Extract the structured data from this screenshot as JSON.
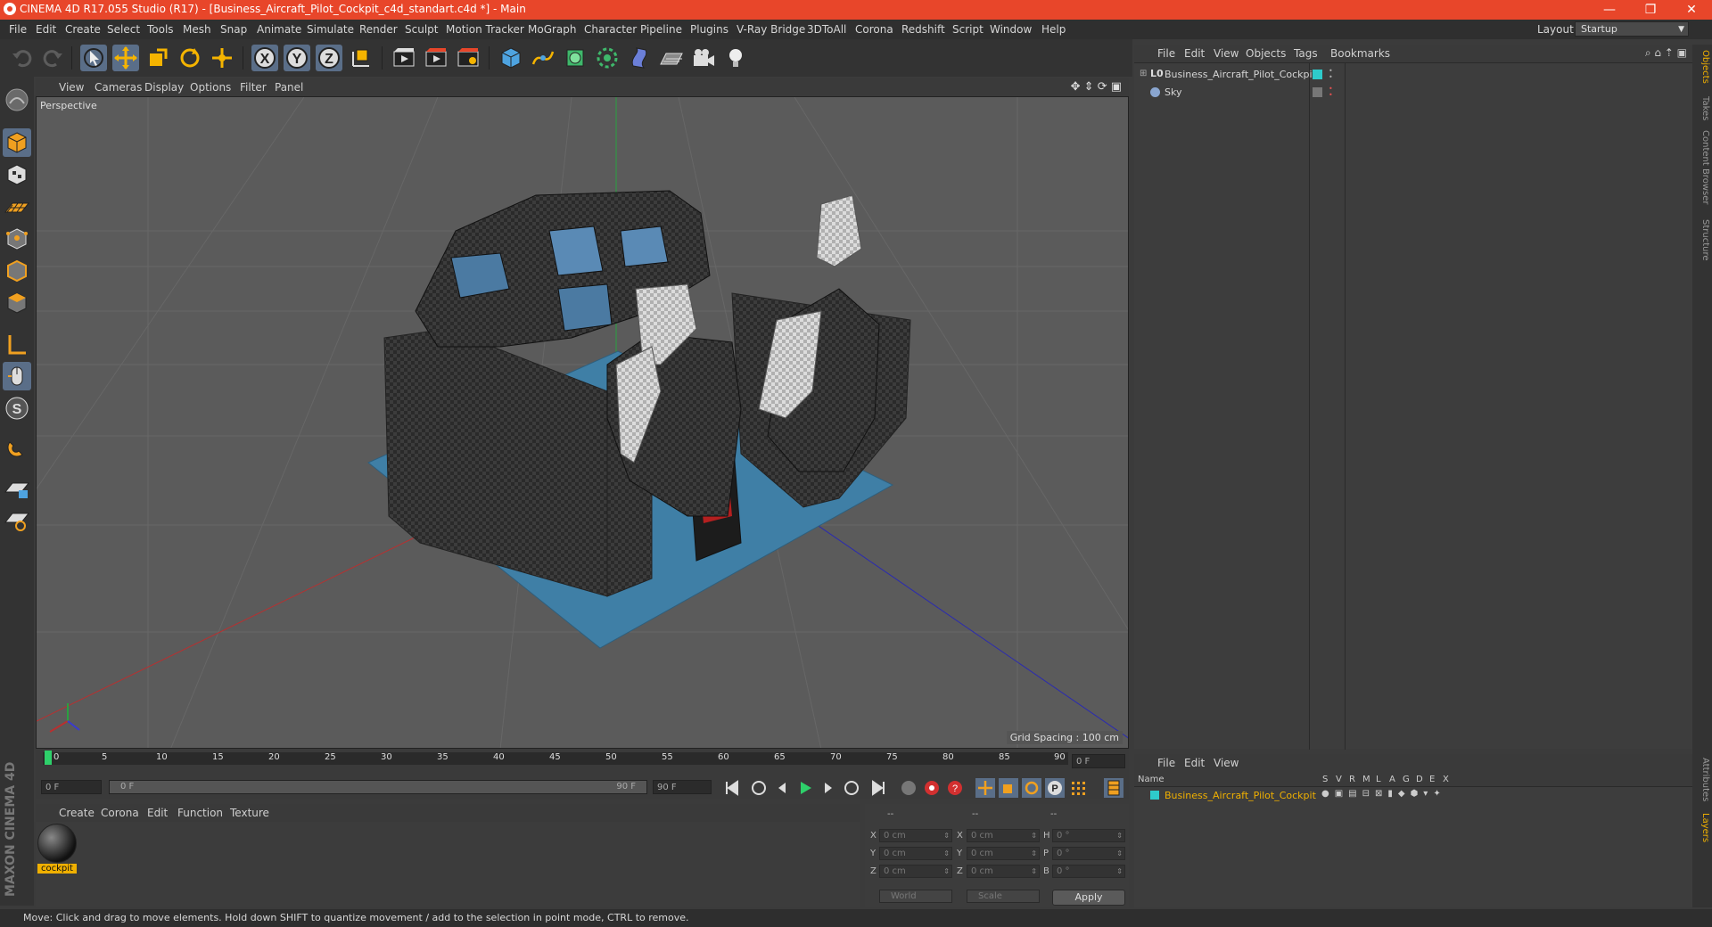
{
  "app": {
    "window_title": "CINEMA 4D R17.055 Studio (R17) - [Business_Aircraft_Pilot_Cockpit_c4d_standart.c4d *] - Main",
    "accent_color": "#e8462a"
  },
  "window_controls": {
    "minimize": "—",
    "maximize": "❐",
    "close": "✕"
  },
  "menubar": {
    "items": [
      "File",
      "Edit",
      "Create",
      "Select",
      "Tools",
      "Mesh",
      "Snap",
      "Animate",
      "Simulate",
      "Render",
      "Sculpt",
      "Motion Tracker",
      "MoGraph",
      "Character",
      "Pipeline",
      "Plugins",
      "V-Ray Bridge",
      "3DToAll",
      "Corona",
      "Redshift",
      "Script",
      "Window",
      "Help"
    ],
    "layout_label": "Layout:",
    "layout_value": "Startup"
  },
  "toolbar": {
    "icons": [
      "undo-icon",
      "redo-icon",
      "select-arrow-icon",
      "move-icon",
      "scale-icon",
      "rotate-icon",
      "transform-icon",
      "x-axis-icon",
      "y-axis-icon",
      "z-axis-icon",
      "world-coord-icon",
      "render-view-icon",
      "render-picture-viewer-icon",
      "render-settings-icon",
      "cube-icon",
      "pen-spline-icon",
      "subdivision-icon",
      "array-icon",
      "deformer-icon",
      "floor-icon",
      "camera-icon",
      "light-icon"
    ],
    "axis_labels": [
      "X",
      "Y",
      "Z"
    ]
  },
  "lefttools": {
    "icons": [
      "make-editable-icon",
      "model-mode-icon",
      "texture-mode-icon",
      "workplane-icon",
      "points-mode-icon",
      "edges-mode-icon",
      "polygons-mode-icon",
      "axis-mode-icon",
      "tweak-icon",
      "solo-icon",
      "snap-icon",
      "lock-workplane-icon",
      "planar-workplane-icon"
    ],
    "brand": "MAXON CINEMA 4D"
  },
  "viewport": {
    "menu": [
      "View",
      "Cameras",
      "Display",
      "Options",
      "Filter",
      "Panel"
    ],
    "label": "Perspective",
    "grid_spacing": "Grid Spacing : 100 cm"
  },
  "timeline": {
    "ticks": [
      "0",
      "5",
      "10",
      "15",
      "20",
      "25",
      "30",
      "35",
      "40",
      "45",
      "50",
      "55",
      "60",
      "65",
      "70",
      "75",
      "80",
      "85",
      "90"
    ],
    "current_frame": "0 F",
    "start_field": "0 F",
    "range_start": "0 F",
    "range_end": "90 F",
    "end_field": "90 F"
  },
  "material_manager": {
    "menu": [
      "Create",
      "Corona",
      "Edit",
      "Function",
      "Texture"
    ],
    "materials": [
      {
        "name": "cockpit"
      }
    ]
  },
  "coordinates": {
    "headers": [
      "--",
      "--",
      "--"
    ],
    "rows": [
      {
        "pos_label": "X",
        "pos": "0 cm",
        "size_label": "X",
        "size": "0 cm",
        "rot_label": "H",
        "rot": "0 °"
      },
      {
        "pos_label": "Y",
        "pos": "0 cm",
        "size_label": "Y",
        "size": "0 cm",
        "rot_label": "P",
        "rot": "0 °"
      },
      {
        "pos_label": "Z",
        "pos": "0 cm",
        "size_label": "Z",
        "size": "0 cm",
        "rot_label": "B",
        "rot": "0 °"
      }
    ],
    "mode_select": "World",
    "scale_select": "Scale",
    "apply_label": "Apply"
  },
  "object_manager": {
    "menu": [
      "File",
      "Edit",
      "View",
      "Objects",
      "Tags",
      "Bookmarks"
    ],
    "objects": [
      {
        "name": "Business_Aircraft_Pilot_Cockpit",
        "tag_color": "#2ecbcb"
      },
      {
        "name": "Sky"
      }
    ]
  },
  "layer_manager": {
    "menu": [
      "File",
      "Edit",
      "View"
    ],
    "columns": [
      "Name",
      "S",
      "V",
      "R",
      "M",
      "L",
      "A",
      "G",
      "D",
      "E",
      "X"
    ],
    "layers": [
      {
        "name": "Business_Aircraft_Pilot_Cockpit",
        "color": "#2ecbcb",
        "text_color": "#f0b000"
      }
    ]
  },
  "side_tabs": [
    "Objects",
    "Takes",
    "Content Browser",
    "Structure",
    "Attributes",
    "Layers"
  ],
  "status": {
    "text": "Move: Click and drag to move elements. Hold down SHIFT to quantize movement / add to the selection in point mode, CTRL to remove."
  }
}
